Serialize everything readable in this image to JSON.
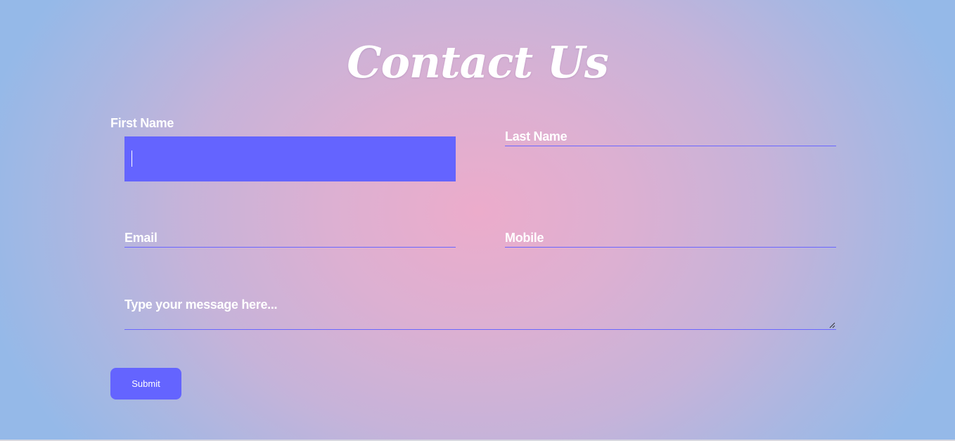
{
  "page": {
    "title": "Contact Us"
  },
  "form": {
    "first_name": {
      "label": "First Name",
      "value": ""
    },
    "last_name": {
      "placeholder": "Last Name"
    },
    "email": {
      "placeholder": "Email"
    },
    "mobile": {
      "placeholder": "Mobile"
    },
    "message": {
      "placeholder": "Type your message here..."
    },
    "submit_label": "Submit"
  },
  "colors": {
    "accent": "#6464ff",
    "text": "#ffffff",
    "bg_center": "#ecaccb",
    "bg_edge": "#95b9e8"
  }
}
